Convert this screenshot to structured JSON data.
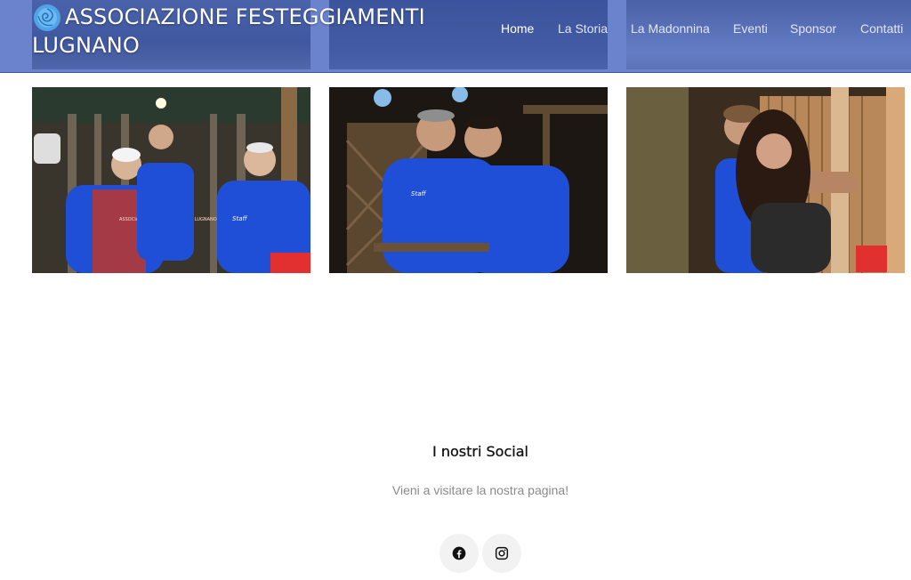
{
  "header": {
    "brand_title": "ASSOCIAZIONE FESTEGGIAMENTI LUGNANO",
    "logo_icon": "blue-rose-logo",
    "background_color": "#4060be"
  },
  "nav": {
    "items": [
      {
        "label": "Home",
        "active": true
      },
      {
        "label": "La Storia",
        "active": false
      },
      {
        "label": "La Madonnina",
        "active": false
      },
      {
        "label": "Eventi",
        "active": false
      },
      {
        "label": "Sponsor",
        "active": false
      },
      {
        "label": "Contatti",
        "active": false
      }
    ]
  },
  "gallery": {
    "photos": [
      {
        "caption_text": "ASSOCIAZIONE FESTEGGIAMENTI LUGNANO",
        "staff_text": "Staff"
      },
      {
        "staff_text": "Staff"
      },
      {}
    ]
  },
  "social": {
    "heading": "I nostri Social",
    "text": "Vieni a visitare la nostra pagina!",
    "buttons": [
      {
        "icon": "facebook-icon"
      },
      {
        "icon": "instagram-icon"
      }
    ]
  },
  "colors": {
    "shirt_blue": "#1f4fd6",
    "text_muted": "#8a8a8a"
  }
}
